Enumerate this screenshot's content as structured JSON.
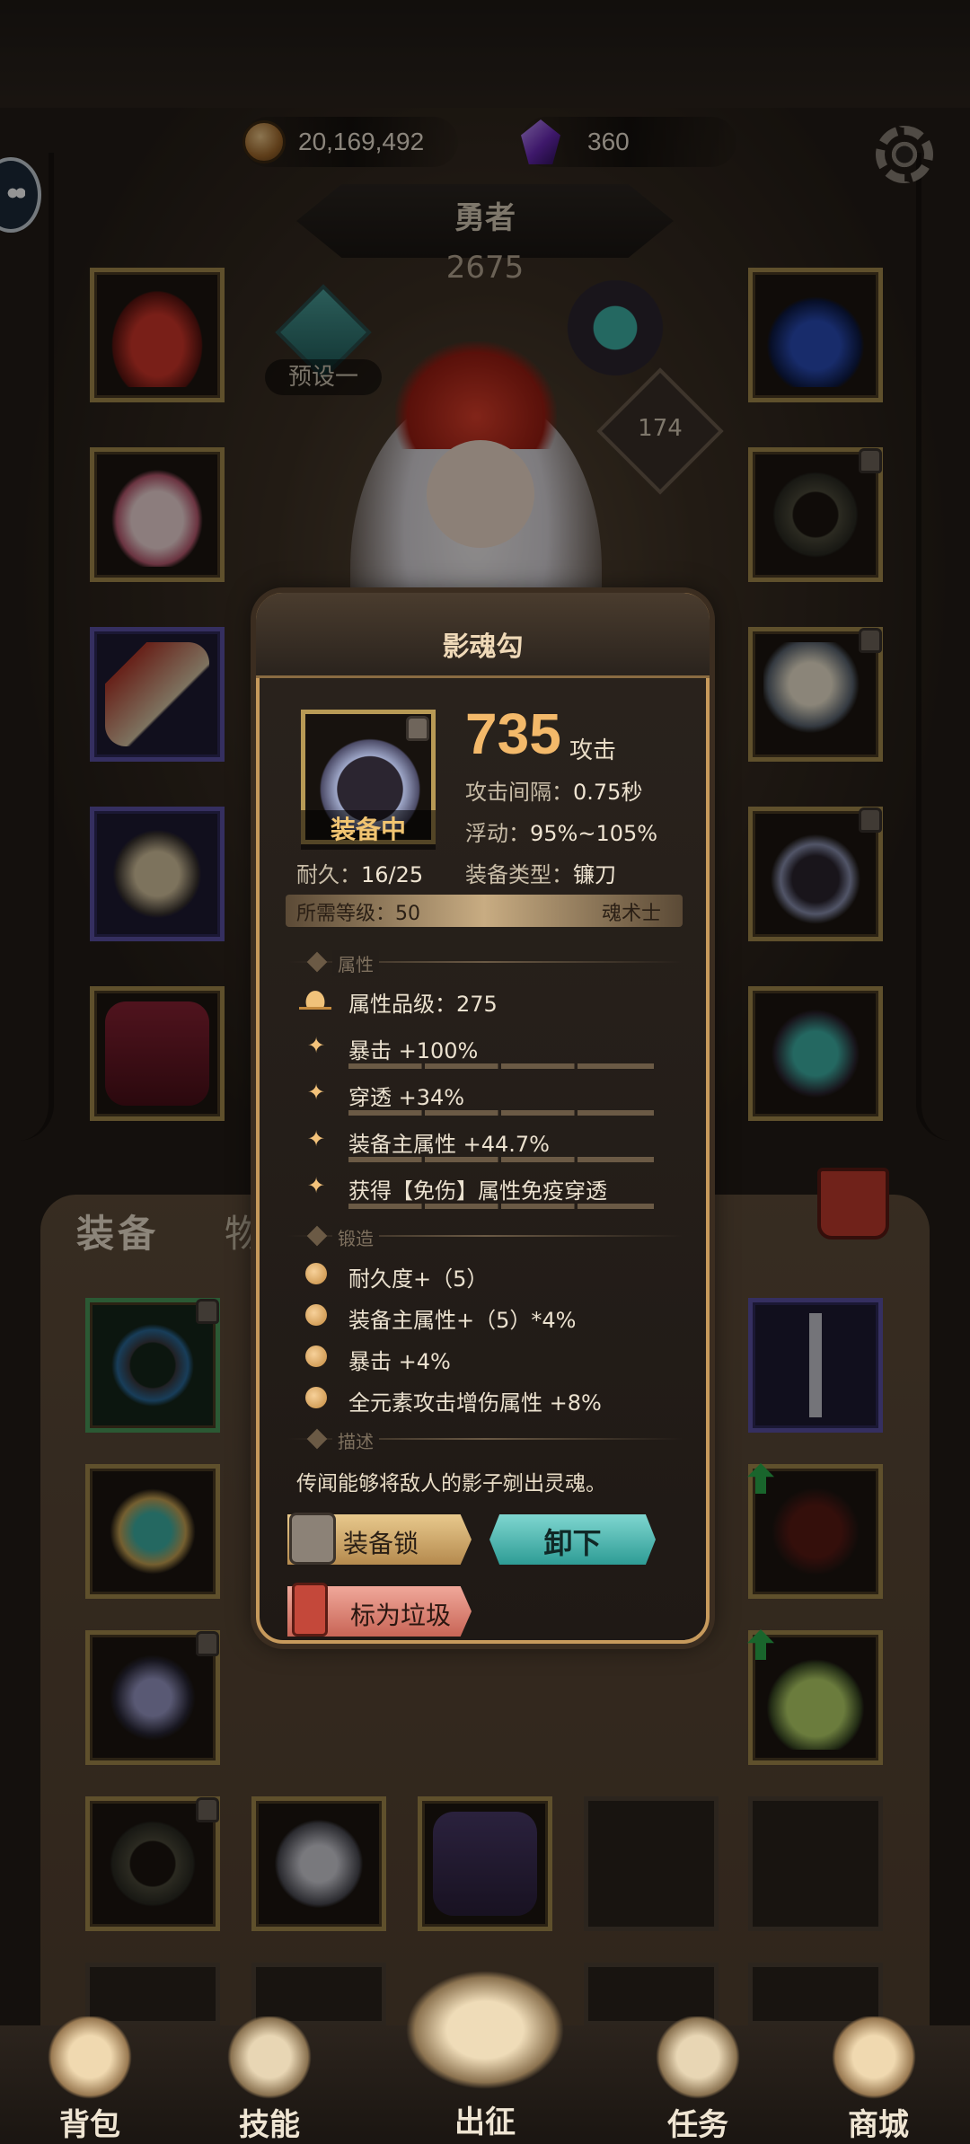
{
  "resources": {
    "gold": "20,169,492",
    "gems": "360"
  },
  "hero": {
    "title": "勇者",
    "power": "2675",
    "preset": "预设一",
    "pet_level": "174"
  },
  "bag_tabs": {
    "equip": "装备",
    "items": "物品"
  },
  "popup": {
    "title": "影魂勾",
    "equipped_label": "装备中",
    "attack_value": "735",
    "attack_unit": "攻击",
    "attack_interval": {
      "label": "攻击间隔：",
      "value": "0.75秒"
    },
    "float": {
      "label": "浮动：",
      "value": "95%~105%"
    },
    "durability": {
      "label": "耐久：",
      "value": "16/25"
    },
    "equip_type": {
      "label": "装备类型：",
      "value": "镰刀"
    },
    "required_level": "所需等级：50",
    "class": "魂术士",
    "section_attributes": "属性",
    "attribute_grade": "属性品级：275",
    "attributes": [
      "暴击 +100%",
      "穿透 +34%",
      "装备主属性 +44.7%",
      "获得【免伤】属性免疫穿透"
    ],
    "section_forge": "锻造",
    "forge": [
      "耐久度+（5）",
      "装备主属性+（5）*4%",
      "暴击 +4%",
      "全元素攻击增伤属性 +8%"
    ],
    "section_desc": "描述",
    "description": "传闻能够将敌人的影子剜出灵魂。",
    "lock_button": "装备锁",
    "unequip_button": "卸下",
    "junk_button": "标为垃圾"
  },
  "nav": [
    "背包",
    "技能",
    "出征",
    "任务",
    "商城"
  ],
  "colors": {
    "accent_gold": "#f3b96a",
    "teal_button": "#2e9c95",
    "frame_gold": "#c79a5c"
  }
}
